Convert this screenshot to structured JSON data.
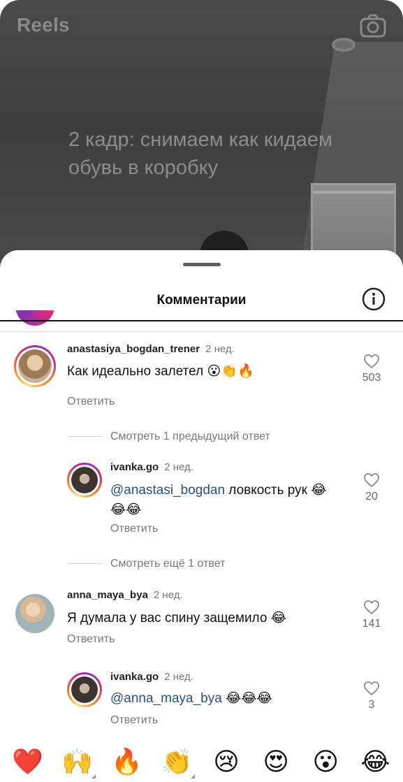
{
  "video": {
    "title": "Reels",
    "overlay_text": "2 кадр: снимаем как кидаем обувь в коробку",
    "camera_icon": "camera-icon"
  },
  "sheet": {
    "title": "Комментарии",
    "info_icon": "info-icon"
  },
  "comments": [
    {
      "username": "anastasiya_bogdan_trener",
      "time": "2 нед.",
      "text": "Как идеально залетел 😮👏🔥",
      "likes": "503",
      "reply_label": "Ответить",
      "view_replies": "Смотреть 1 предыдущий ответ"
    },
    {
      "username": "ivanka.go",
      "time": "2 нед.",
      "mention": "@anastasi_bogdan",
      "text_line1": " ловкость рук 😂",
      "text_line2": "😂😂",
      "likes": "20",
      "reply_label": "Ответить",
      "view_replies": "Смотреть ещё 1 ответ"
    },
    {
      "username": "anna_maya_bya",
      "time": "2 нед.",
      "text": "Я думала у вас спину защемило 😂",
      "likes": "141",
      "reply_label": "Ответить"
    },
    {
      "username": "ivanka.go",
      "time": "2 нед.",
      "mention": "@anna_maya_bya",
      "text": " 😂😂😂",
      "likes": "3",
      "reply_label": "Ответить"
    }
  ],
  "emoji_bar": [
    "❤️",
    "🙌",
    "🔥",
    "👏",
    "😢",
    "😍",
    "😮",
    "😂"
  ],
  "colors": {
    "mention": "#2b4f7e",
    "muted": "#777777",
    "story_ring": [
      "#feda75",
      "#fa7e1e",
      "#d62976",
      "#962fbf"
    ]
  }
}
